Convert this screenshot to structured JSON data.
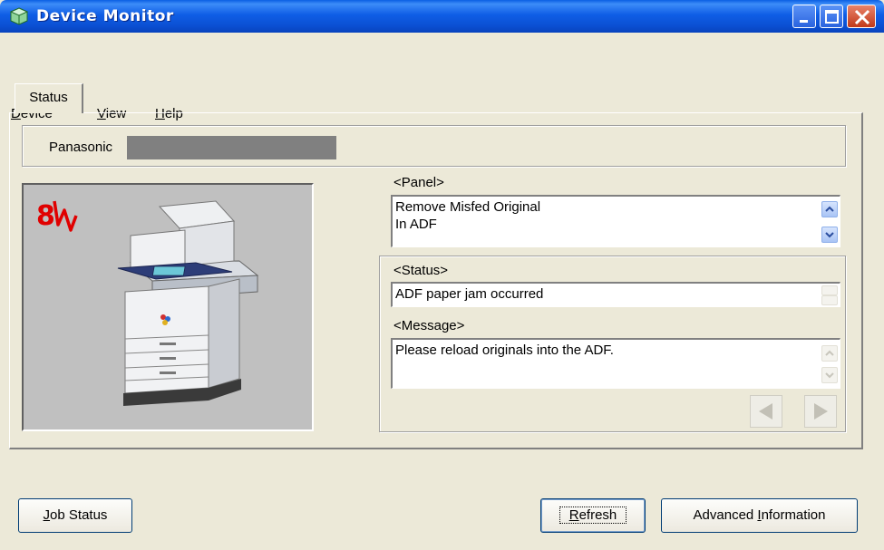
{
  "window": {
    "title": "Device Monitor",
    "controls": [
      "minimize",
      "maximize",
      "close"
    ]
  },
  "menu": {
    "items": [
      {
        "label": "Device",
        "mnemonic": "D",
        "rest": "evice"
      },
      {
        "label": "View",
        "mnemonic": "V",
        "rest": "iew"
      },
      {
        "label": "Help",
        "mnemonic": "H",
        "rest": "elp"
      }
    ]
  },
  "tabs": [
    {
      "label": "Status",
      "selected": true
    }
  ],
  "device": {
    "manufacturer": "Panasonic",
    "model_redacted": true
  },
  "image": {
    "error_icon": "paper-jam-icon",
    "device_picture": "copier-image"
  },
  "panel": {
    "label": "<Panel>",
    "lines": [
      "Remove Misfed Original",
      "In ADF"
    ]
  },
  "status": {
    "label": "<Status>",
    "value": "ADF paper jam occurred"
  },
  "message": {
    "label": "<Message>",
    "value": "Please reload originals into the ADF."
  },
  "buttons": {
    "job_status": {
      "label": "Job Status",
      "mnemonic": "J",
      "rest": "ob Status"
    },
    "refresh": {
      "label": "Refresh",
      "mnemonic": "R",
      "rest": "efresh"
    },
    "advanced": {
      "label": "Advanced Information",
      "before": "Advanced ",
      "mnemonic": "I",
      "rest": "nformation"
    }
  },
  "colors": {
    "titlebar": "#0b4fd2",
    "face": "#ece9d8",
    "error_icon": "#e00000"
  }
}
